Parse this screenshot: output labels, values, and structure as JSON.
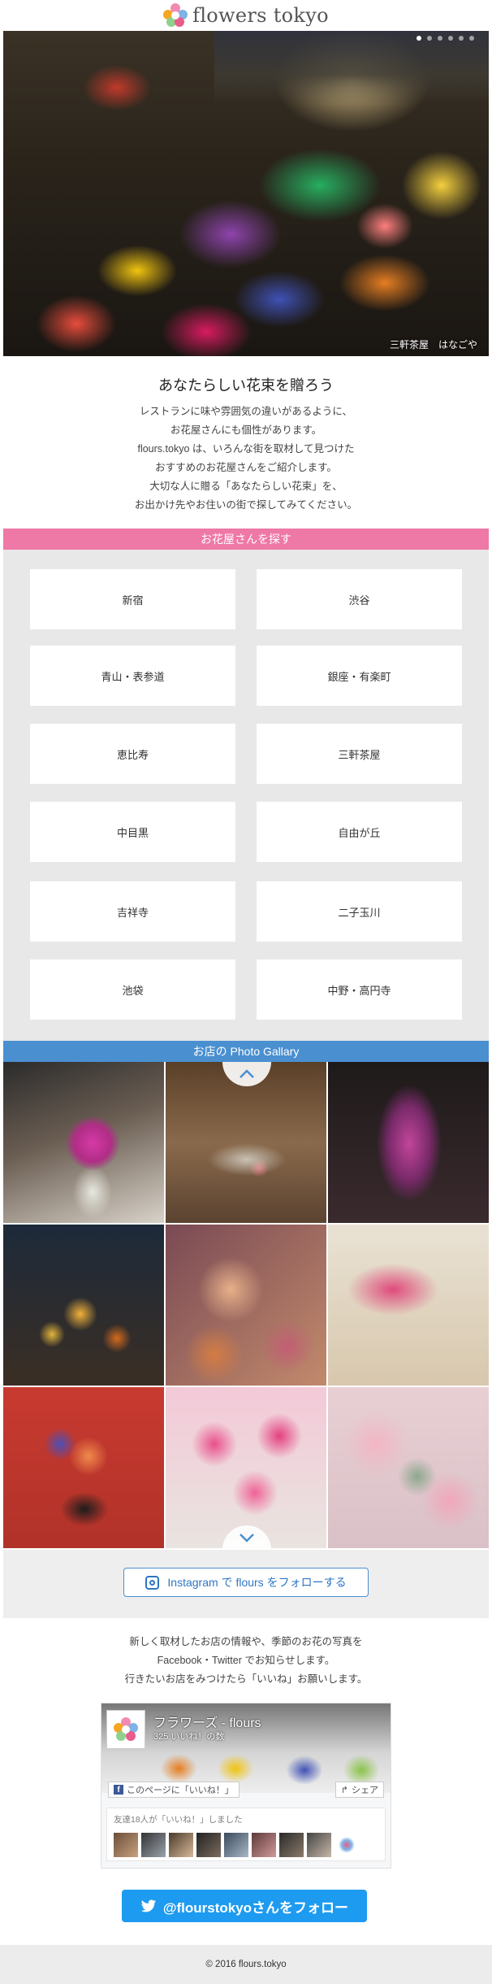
{
  "header": {
    "logo_text": "flowers tokyo",
    "logo_icon": "flower-logo-icon"
  },
  "hero": {
    "caption": "三軒茶屋　はなごや",
    "slide_count": 6,
    "active_slide": 1
  },
  "intro": {
    "title": "あなたらしい花束を贈ろう",
    "lines": [
      "レストランに味や雰囲気の違いがあるように、",
      "お花屋さんにも個性があります。",
      "flours.tokyo は、いろんな街を取材して見つけた",
      "おすすめのお花屋さんをご紹介します。",
      "大切な人に贈る「あなたらしい花束」を、",
      "お出かけ先やお住いの街で探してみてください。"
    ]
  },
  "areas": {
    "heading": "お花屋さんを探す",
    "items": [
      "新宿",
      "渋谷",
      "青山・表参道",
      "銀座・有楽町",
      "恵比寿",
      "三軒茶屋",
      "中目黒",
      "自由が丘",
      "吉祥寺",
      "二子玉川",
      "池袋",
      "中野・高円寺"
    ]
  },
  "gallery": {
    "heading": "お店の Photo Gallary",
    "up_icon": "chevron-up-icon",
    "down_icon": "chevron-down-icon"
  },
  "instagram": {
    "label": "Instagram で flours をフォローする",
    "icon": "instagram-icon"
  },
  "sns": {
    "lines": [
      "新しく取材したお店の情報や、季節のお花の写真を",
      "Facebook・Twitter でお知らせします。",
      "行きたいお店をみつけたら「いいね」お願いします。"
    ]
  },
  "facebook": {
    "page_name": "フラワーズ - flours",
    "likes": "325 いいね！の数",
    "like_button": "このページに「いいね！」",
    "share_button": "シェア",
    "friends_text": "友達18人が「いいね！」しました"
  },
  "twitter": {
    "label": "@flourstokyoさんをフォロー",
    "icon": "twitter-bird-icon"
  },
  "footer": {
    "copyright": "© 2016 flours.tokyo"
  },
  "colors": {
    "pink": "#ee78a6",
    "blue": "#4a8fd0",
    "twitter": "#1d9bf0",
    "facebook": "#3b5998"
  }
}
